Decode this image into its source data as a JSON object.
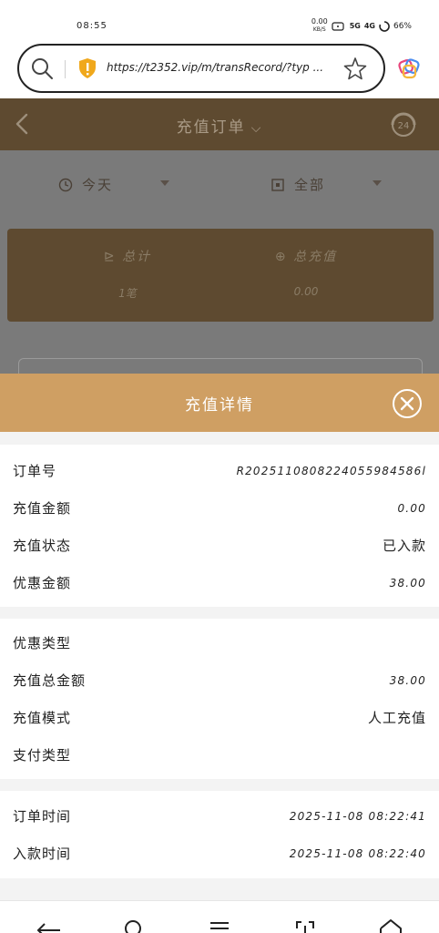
{
  "status_bar": {
    "time": "08:55",
    "net_speed": "0.00",
    "net_unit": "KB/S",
    "signal1": "5G",
    "signal2": "4G",
    "battery": "66%"
  },
  "browser": {
    "url": "https://t2352.vip/m/transRecord/?typ ..."
  },
  "app_header": {
    "title": "充值订单",
    "support_badge": "24"
  },
  "filters": {
    "date": "今天",
    "type": "全部"
  },
  "summary": {
    "count_label": "总计",
    "count_value": "1笔",
    "total_label": "总充值",
    "total_value": "0.00"
  },
  "modal": {
    "title": "充值详情",
    "rows": [
      {
        "label": "订单号",
        "value": "R2025110808224055984586l"
      },
      {
        "label": "充值金额",
        "value": "0.00"
      },
      {
        "label": "充值状态",
        "value": "已入款"
      },
      {
        "label": "优惠金额",
        "value": "38.00"
      },
      {
        "label": "优惠类型",
        "value": ""
      },
      {
        "label": "充值总金额",
        "value": "38.00"
      },
      {
        "label": "充值模式",
        "value": "人工充值"
      },
      {
        "label": "支付类型",
        "value": ""
      },
      {
        "label": "订单时间",
        "value": "2025-11-08 08:22:41"
      },
      {
        "label": "入款时间",
        "value": "2025-11-08 08:22:40"
      }
    ]
  },
  "colors": {
    "modal_header": "#cf9f63",
    "app_header_dimmed": "#5e4a30",
    "overlay": "#7a7a7a"
  }
}
